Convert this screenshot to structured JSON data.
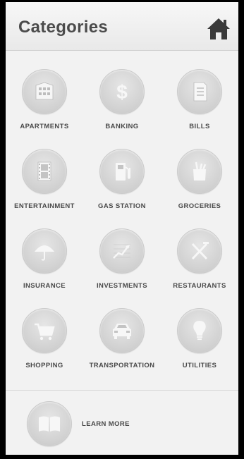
{
  "header": {
    "title": "Categories",
    "home_icon": "home-icon"
  },
  "colors": {
    "background": "#f2f2f2",
    "icon_circle": "#d2d2d2",
    "icon_glyph": "#f7f7f7",
    "text": "#4a4a4a"
  },
  "categories": [
    {
      "label": "APARTMENTS",
      "icon": "building-icon"
    },
    {
      "label": "BANKING",
      "icon": "dollar-icon"
    },
    {
      "label": "BILLS",
      "icon": "document-icon"
    },
    {
      "label": "ENTERTAINMENT",
      "icon": "film-icon"
    },
    {
      "label": "GAS STATION",
      "icon": "fuel-pump-icon"
    },
    {
      "label": "GROCERIES",
      "icon": "grocery-bag-icon"
    },
    {
      "label": "INSURANCE",
      "icon": "umbrella-icon"
    },
    {
      "label": "INVESTMENTS",
      "icon": "trend-chart-icon"
    },
    {
      "label": "RESTAURANTS",
      "icon": "fork-knife-icon"
    },
    {
      "label": "SHOPPING",
      "icon": "shopping-cart-icon"
    },
    {
      "label": "TRANSPORTATION",
      "icon": "car-icon"
    },
    {
      "label": "UTILITIES",
      "icon": "lightbulb-icon"
    }
  ],
  "learn_more": {
    "label": "LEARN MORE",
    "icon": "book-icon"
  }
}
